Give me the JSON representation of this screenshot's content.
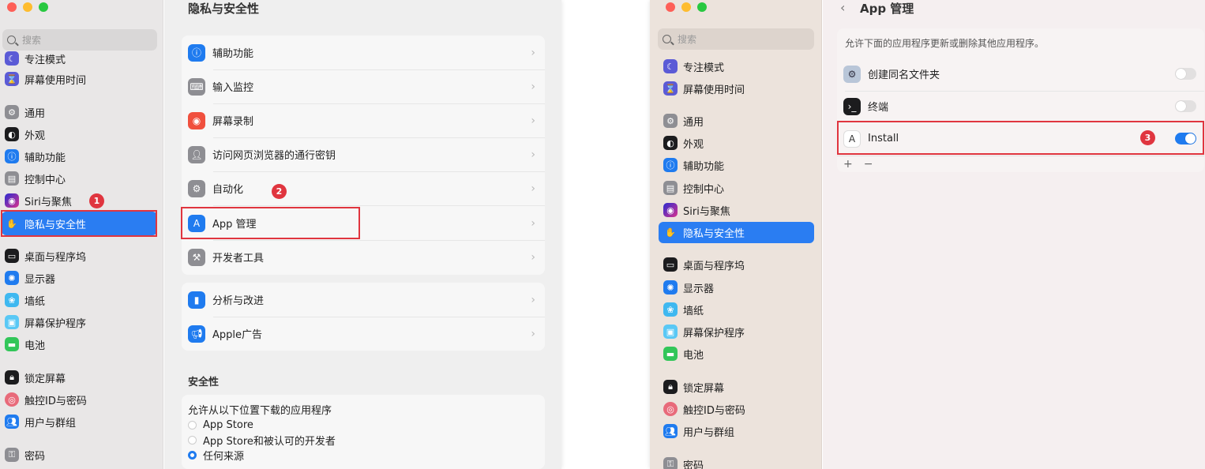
{
  "left_window": {
    "title": "隐私与安全性",
    "search_placeholder": "搜索",
    "sidebar_items": [
      {
        "label": "专注模式",
        "color": "#5b5bd6",
        "icon": "moon-icon"
      },
      {
        "label": "屏幕使用时间",
        "color": "#5b5bd6",
        "icon": "hourglass-icon"
      },
      {
        "label": "通用",
        "color": "#8e8e93",
        "icon": "gear-icon"
      },
      {
        "label": "外观",
        "color": "#1c1c1e",
        "icon": "appearance-icon"
      },
      {
        "label": "辅助功能",
        "color": "#1f7bef",
        "icon": "accessibility-icon"
      },
      {
        "label": "控制中心",
        "color": "#8e8e93",
        "icon": "control-center-icon"
      },
      {
        "label": "Siri与聚焦",
        "color": "#6d3ad6",
        "icon": "siri-icon"
      },
      {
        "label": "隐私与安全性",
        "color": "#2a7df2",
        "icon": "hand-icon"
      },
      {
        "label": "桌面与程序坞",
        "color": "#1c1c1e",
        "icon": "dock-icon"
      },
      {
        "label": "显示器",
        "color": "#1f7bef",
        "icon": "display-icon"
      },
      {
        "label": "墙纸",
        "color": "#3fb8f0",
        "icon": "wallpaper-icon"
      },
      {
        "label": "屏幕保护程序",
        "color": "#5ac8f5",
        "icon": "screensaver-icon"
      },
      {
        "label": "电池",
        "color": "#32c659",
        "icon": "battery-icon"
      },
      {
        "label": "锁定屏幕",
        "color": "#1c1c1e",
        "icon": "lock-icon"
      },
      {
        "label": "触控ID与密码",
        "color": "#e86a7a",
        "icon": "fingerprint-icon"
      },
      {
        "label": "用户与群组",
        "color": "#1f7bef",
        "icon": "users-icon"
      },
      {
        "label": "密码",
        "color": "#8e8e93",
        "icon": "key-icon"
      }
    ],
    "privacy_rows": [
      {
        "label": "辅助功能",
        "color": "#1f7bef",
        "icon": "accessibility-icon"
      },
      {
        "label": "输入监控",
        "color": "#8e8e93",
        "icon": "keyboard-icon"
      },
      {
        "label": "屏幕录制",
        "color": "#f0503e",
        "icon": "record-icon"
      },
      {
        "label": "访问网页浏览器的通行密钥",
        "color": "#8e8e93",
        "icon": "passkey-icon"
      },
      {
        "label": "自动化",
        "color": "#8e8e93",
        "icon": "automation-icon"
      },
      {
        "label": "App 管理",
        "color": "#1f7bef",
        "icon": "app-store-icon"
      },
      {
        "label": "开发者工具",
        "color": "#8e8e93",
        "icon": "hammer-icon"
      }
    ],
    "analytics_rows": [
      {
        "label": "分析与改进",
        "color": "#1f7bef",
        "icon": "chart-icon"
      },
      {
        "label": "Apple广告",
        "color": "#1f7bef",
        "icon": "megaphone-icon"
      }
    ],
    "security": {
      "title": "安全性",
      "allow_label": "允许从以下位置下载的应用程序",
      "options": [
        "App Store",
        "App Store和被认可的开发者",
        "任何来源"
      ],
      "selected": "任何来源"
    },
    "badges": [
      "1",
      "2"
    ]
  },
  "right_window": {
    "title": "App 管理",
    "search_placeholder": "搜索",
    "description": "允许下面的应用程序更新或删除其他应用程序。",
    "apps": [
      {
        "label": "创建同名文件夹",
        "enabled": false,
        "icon": "automator-icon"
      },
      {
        "label": "终端",
        "enabled": false,
        "icon": "terminal-icon"
      },
      {
        "label": "Install",
        "enabled": true,
        "icon": "installer-icon"
      }
    ],
    "add_label": "+",
    "remove_label": "−",
    "badge": "3",
    "sidebar_items": [
      {
        "label": "专注模式",
        "color": "#5b5bd6",
        "icon": "moon-icon"
      },
      {
        "label": "屏幕使用时间",
        "color": "#5b5bd6",
        "icon": "hourglass-icon"
      },
      {
        "label": "通用",
        "color": "#8e8e93",
        "icon": "gear-icon"
      },
      {
        "label": "外观",
        "color": "#1c1c1e",
        "icon": "appearance-icon"
      },
      {
        "label": "辅助功能",
        "color": "#1f7bef",
        "icon": "accessibility-icon"
      },
      {
        "label": "控制中心",
        "color": "#8e8e93",
        "icon": "control-center-icon"
      },
      {
        "label": "Siri与聚焦",
        "color": "#6d3ad6",
        "icon": "siri-icon"
      },
      {
        "label": "隐私与安全性",
        "color": "#2a7df2",
        "icon": "hand-icon"
      },
      {
        "label": "桌面与程序坞",
        "color": "#1c1c1e",
        "icon": "dock-icon"
      },
      {
        "label": "显示器",
        "color": "#1f7bef",
        "icon": "display-icon"
      },
      {
        "label": "墙纸",
        "color": "#3fb8f0",
        "icon": "wallpaper-icon"
      },
      {
        "label": "屏幕保护程序",
        "color": "#5ac8f5",
        "icon": "screensaver-icon"
      },
      {
        "label": "电池",
        "color": "#32c659",
        "icon": "battery-icon"
      },
      {
        "label": "锁定屏幕",
        "color": "#1c1c1e",
        "icon": "lock-icon"
      },
      {
        "label": "触控ID与密码",
        "color": "#e86a7a",
        "icon": "fingerprint-icon"
      },
      {
        "label": "用户与群组",
        "color": "#1f7bef",
        "icon": "users-icon"
      },
      {
        "label": "密码",
        "color": "#8e8e93",
        "icon": "key-icon"
      }
    ]
  }
}
